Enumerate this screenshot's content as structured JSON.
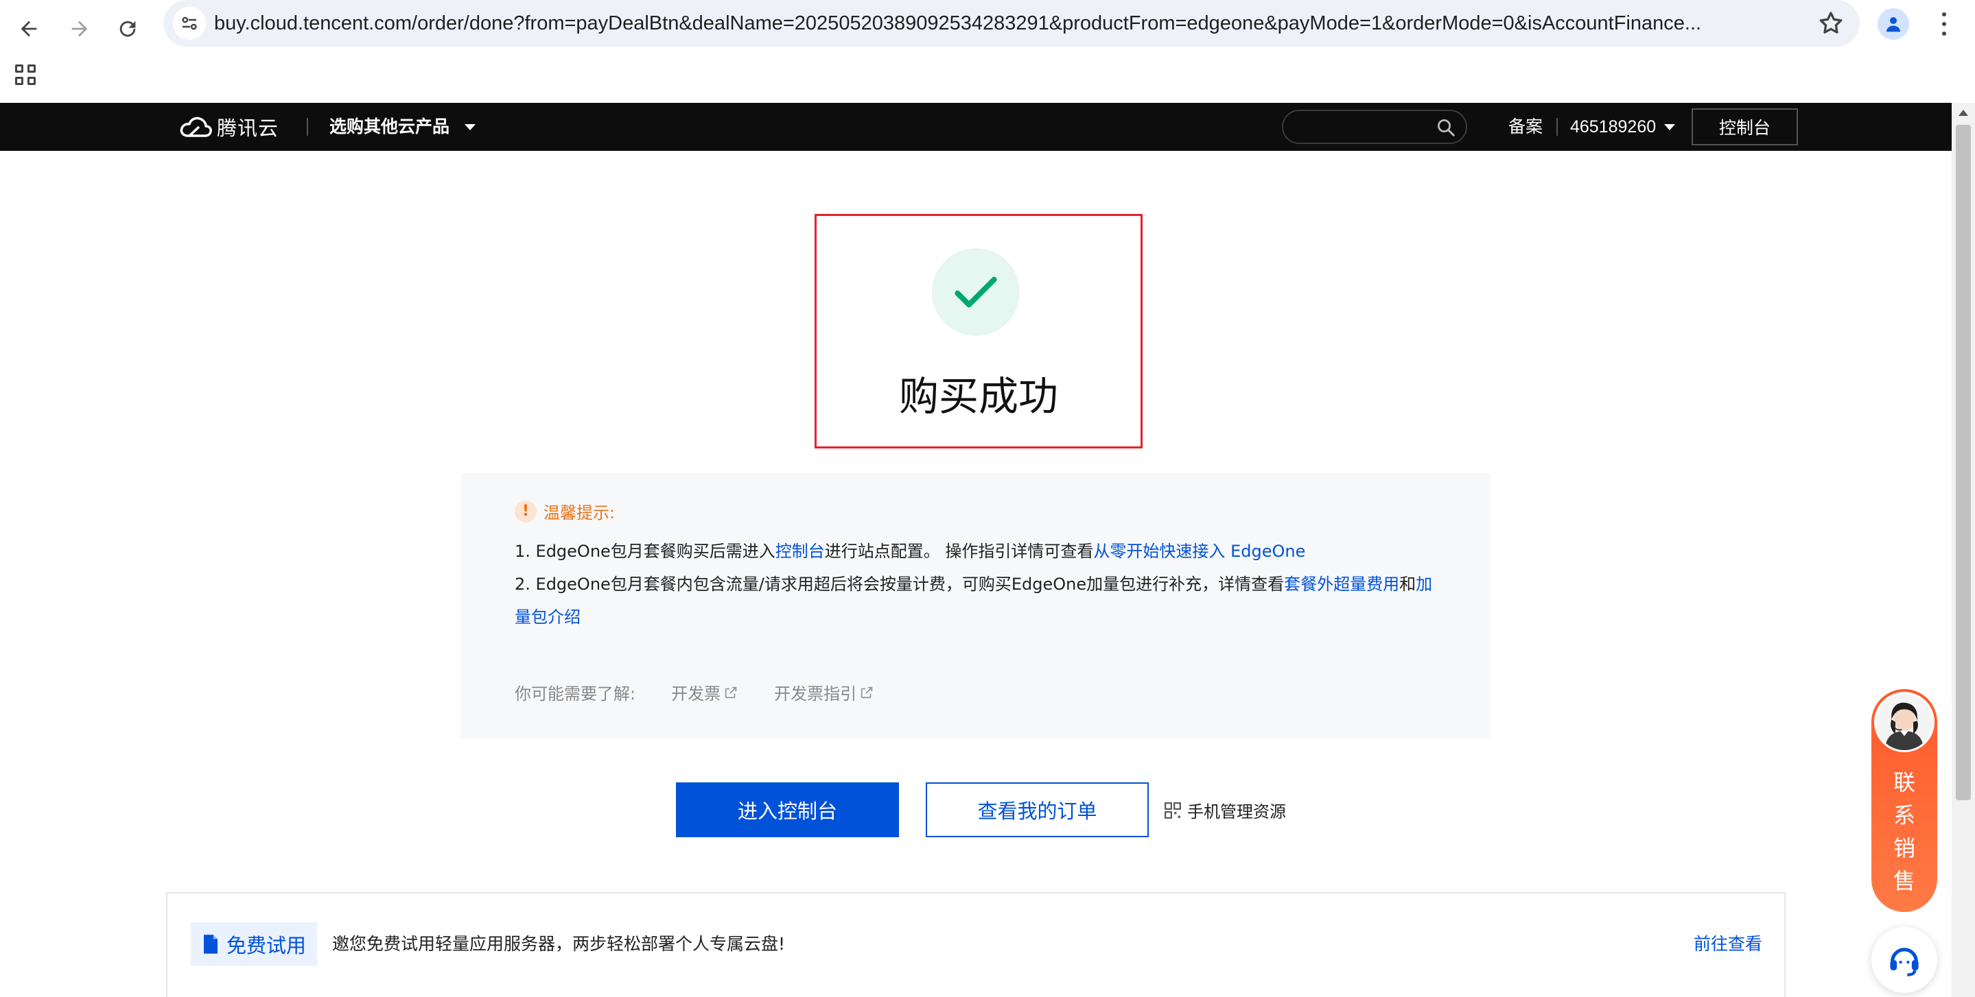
{
  "browser": {
    "url": "buy.cloud.tencent.com/order/done?from=payDealBtn&dealName=20250520389092534283291&productFrom=edgeone&payMode=1&orderMode=0&isAccountFinance..."
  },
  "topbar": {
    "logo_text": "腾讯云",
    "products_label": "选购其他云产品",
    "search_placeholder": "",
    "beian": "备案",
    "account": "465189260",
    "console": "控制台"
  },
  "success": {
    "title": "购买成功"
  },
  "tips": {
    "title": "温馨提示:",
    "line1": {
      "prefix": "1. EdgeOne包月套餐购买后需进入",
      "link1": "控制台",
      "middle": "进行站点配置。 操作指引详情可查看",
      "link2": "从零开始快速接入 EdgeOne"
    },
    "line2": {
      "prefix": "2. EdgeOne包月套餐内包含流量/请求用超后将会按量计费，可购买EdgeOne加量包进行补充，详情查看",
      "link1": "套餐外超量费用",
      "middle": "和",
      "link2": "加量包介绍"
    },
    "may_need": "你可能需要了解:",
    "links": [
      "开发票",
      "开发票指引"
    ]
  },
  "actions": {
    "primary": "进入控制台",
    "secondary": "查看我的订单",
    "mobile": "手机管理资源"
  },
  "trial": {
    "tag": "免费试用",
    "text": "邀您免费试用轻量应用服务器，两步轻松部署个人专属云盘!",
    "link": "前往查看"
  },
  "sales": {
    "label": "联系销售"
  },
  "colors": {
    "brand_blue": "#0052d9",
    "success_green": "#00a870",
    "highlight_red": "#e8202d",
    "warn_orange": "#e8741a",
    "sales_orange": "#ff5a2c"
  }
}
